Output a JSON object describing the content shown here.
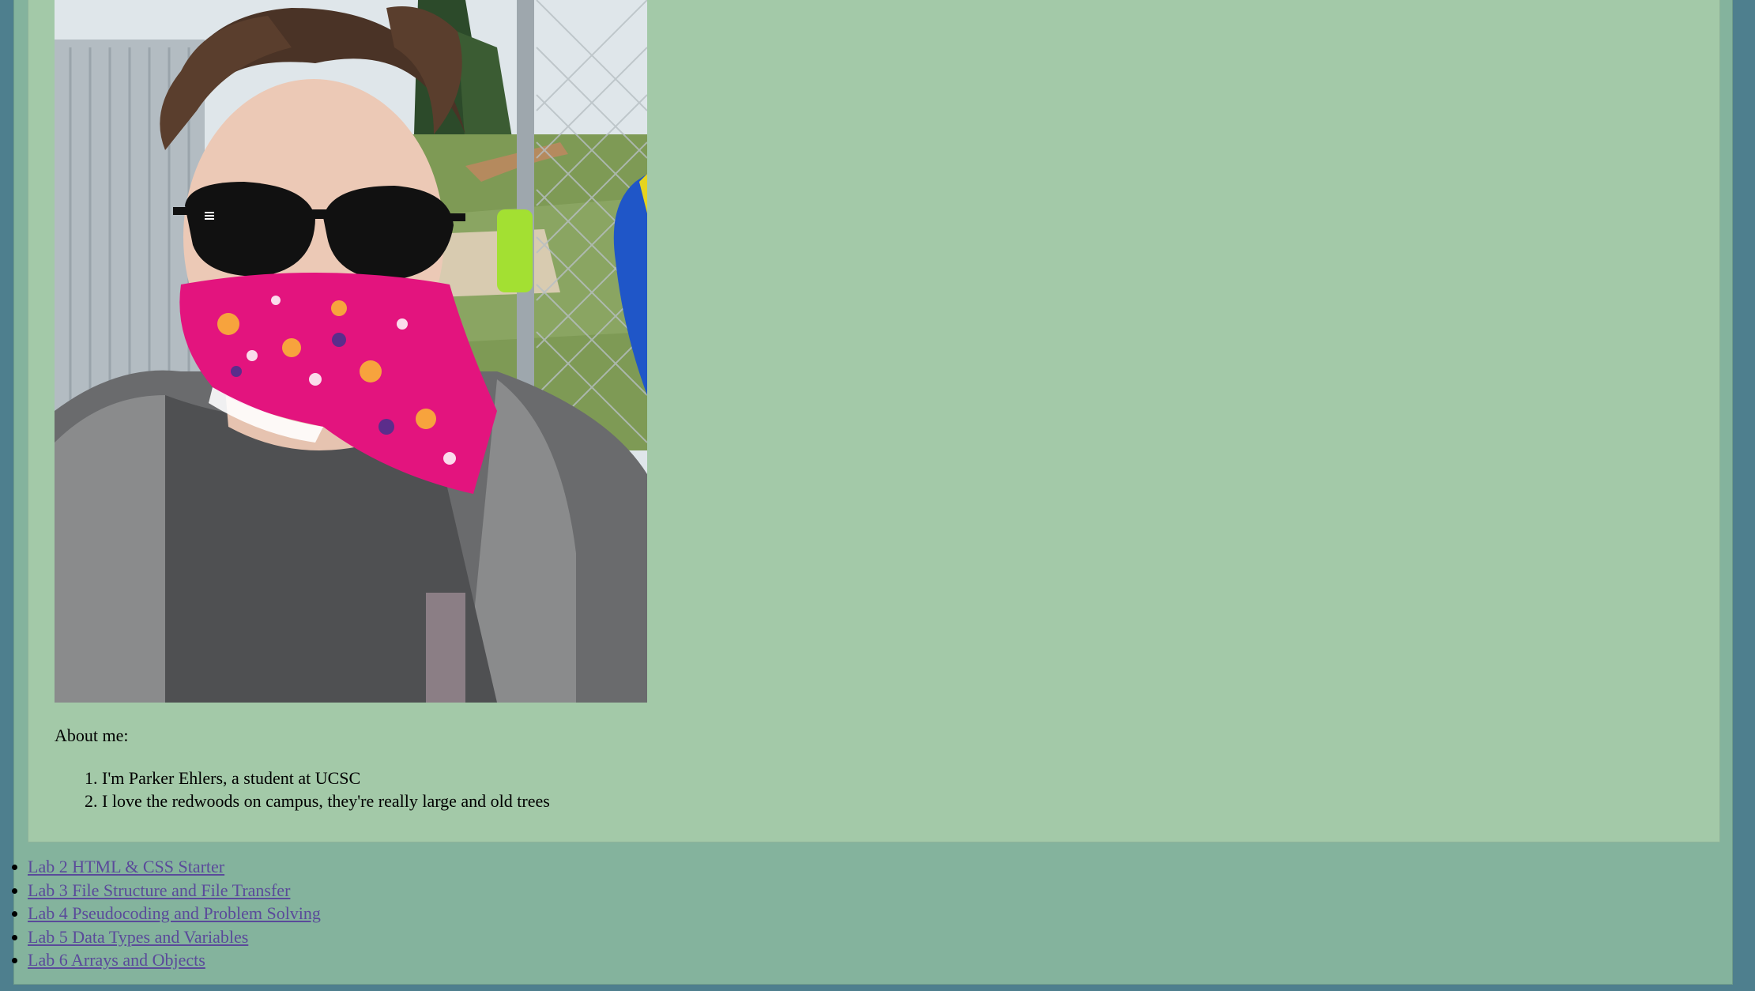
{
  "profile": {
    "photo_alt": "Selfie of Parker Ehlers wearing sunglasses and a pink paisley bandana mask",
    "about_heading": "About me:",
    "facts": [
      "I'm Parker Ehlers, a student at UCSC",
      "I love the redwoods on campus, they're really large and old trees"
    ]
  },
  "nav": {
    "links": [
      "Lab 2 HTML & CSS Starter",
      "Lab 3 File Structure and File Transfer",
      "Lab 4 Pseudocoding and Problem Solving",
      "Lab 5 Data Types and Variables",
      "Lab 6 Arrays and Objects"
    ]
  },
  "colors": {
    "page_background": "#4e7f8e",
    "outer_panel": "#84b39d",
    "inner_panel": "#a3c9a8",
    "link": "#5a4a9a"
  }
}
